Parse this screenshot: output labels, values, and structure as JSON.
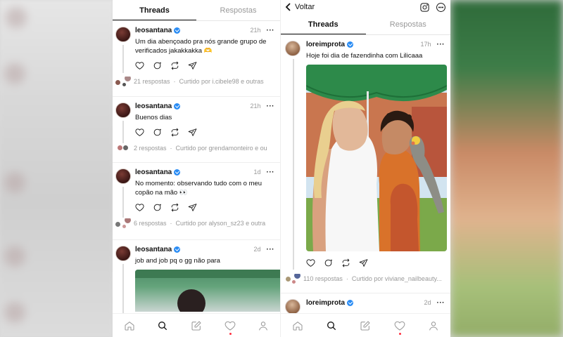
{
  "left": {
    "tabs": [
      "Threads",
      "Respostas"
    ],
    "posts": [
      {
        "user": "leosantana",
        "time": "21h",
        "text": "Um dia abençoado pra nós grande grupo de verificados jakakkakka 🫶",
        "replies": "21 respostas",
        "liked": "Curtido por i.cibele98 e outras"
      },
      {
        "user": "leosantana",
        "time": "21h",
        "text": "Buenos dias",
        "replies": "2 respostas",
        "liked": "Curtido por grendamonteiro e ou"
      },
      {
        "user": "leosantana",
        "time": "1d",
        "text": "No momento: observando tudo com o meu copão na mão 👀",
        "replies": "6 respostas",
        "liked": "Curtido por alyson_sz23 e outra"
      },
      {
        "user": "leosantana",
        "time": "2d",
        "text": "job and job pq o gg não para"
      }
    ]
  },
  "right": {
    "back_label": "Voltar",
    "tabs": [
      "Threads",
      "Respostas"
    ],
    "posts": [
      {
        "user": "loreimprota",
        "time": "17h",
        "text": "Hoje foi dia de fazendinha com Lilicaaa",
        "replies": "110 respostas",
        "liked": "Curtido por viviane_nailbeauty..."
      },
      {
        "user": "loreimprota",
        "time": "2d"
      }
    ]
  },
  "icons": {
    "actions": [
      "heart-icon",
      "comment-icon",
      "repost-icon",
      "share-icon"
    ],
    "nav": [
      "home-icon",
      "search-icon",
      "compose-icon",
      "activity-icon",
      "profile-icon"
    ]
  },
  "colors": {
    "verified": "#2a8cf4",
    "notification_dot": "#ff3040",
    "canopy_green": "#2d8a4a"
  }
}
